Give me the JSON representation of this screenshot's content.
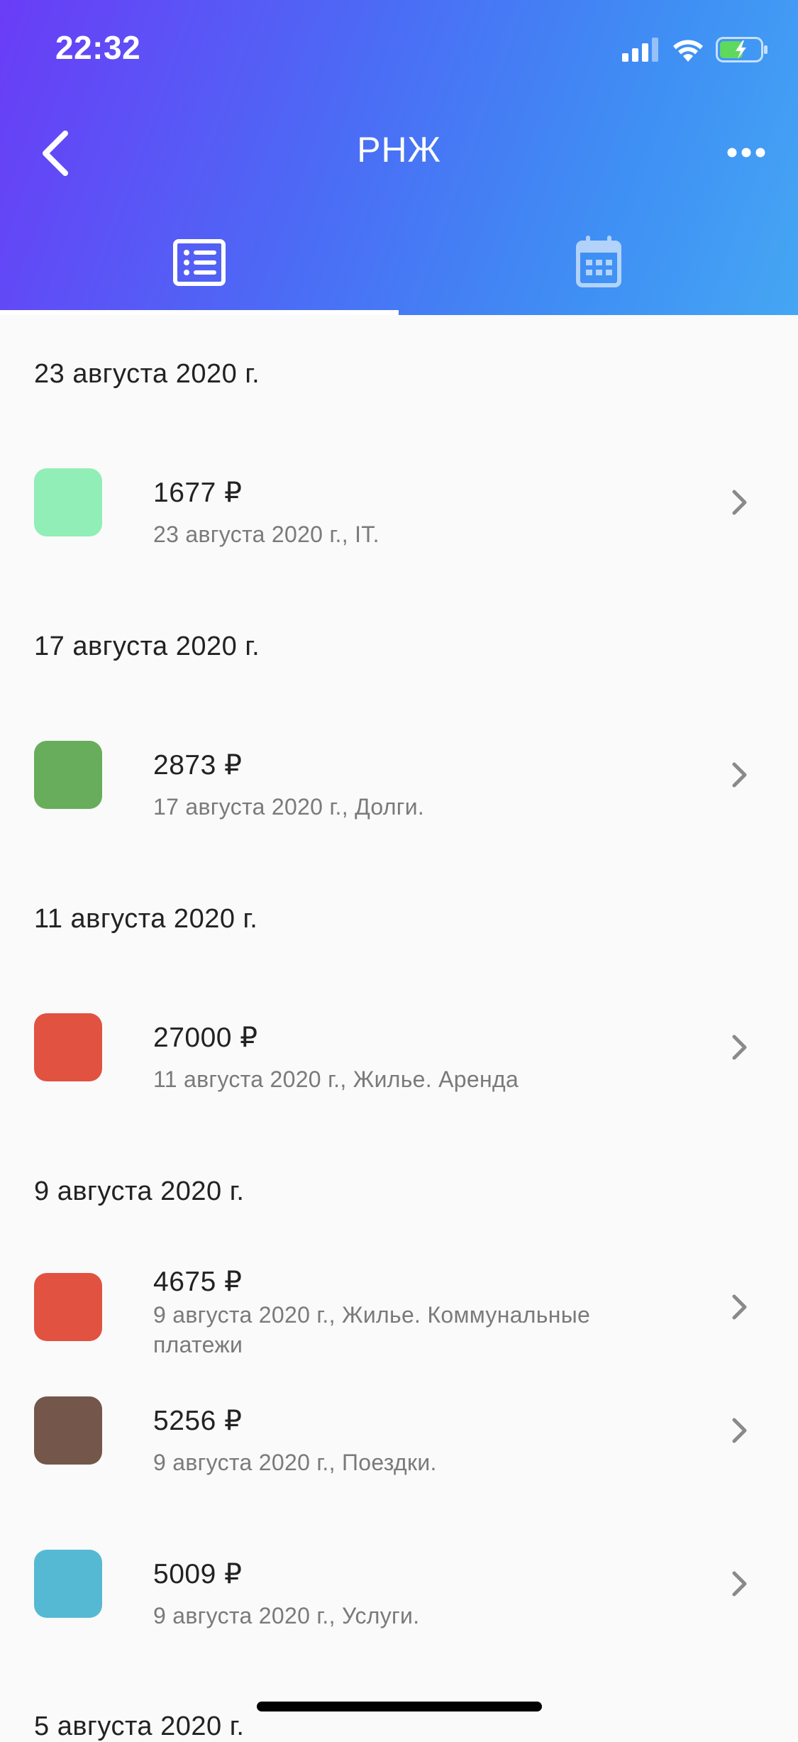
{
  "status_bar": {
    "time": "22:32"
  },
  "nav": {
    "title": "РНЖ"
  },
  "tabs": [
    {
      "name": "list-tab",
      "icon": "list-icon",
      "selected": true
    },
    {
      "name": "calendar-tab",
      "icon": "calendar-icon",
      "selected": false
    }
  ],
  "groups": [
    {
      "date": "23 августа 2020 г.",
      "items": [
        {
          "amount": "1677 ₽",
          "subtitle": "23 августа 2020 г., IT.",
          "color": "#90eeb6"
        }
      ]
    },
    {
      "date": "17 августа 2020 г.",
      "items": [
        {
          "amount": "2873 ₽",
          "subtitle": "17 августа 2020 г., Долги.",
          "color": "#67ad5b"
        }
      ]
    },
    {
      "date": "11 августа 2020 г.",
      "items": [
        {
          "amount": "27000 ₽",
          "subtitle": "11 августа 2020 г., Жилье. Аренда",
          "color": "#e15241"
        }
      ]
    },
    {
      "date": "9 августа 2020 г.",
      "items": [
        {
          "amount": "4675 ₽",
          "subtitle": "9 августа 2020 г., Жилье. Коммунальные платежи",
          "color": "#e15241"
        },
        {
          "amount": "5256 ₽",
          "subtitle": "9 августа 2020 г., Поездки.",
          "color": "#74574a"
        },
        {
          "amount": "5009 ₽",
          "subtitle": "9 августа 2020 г., Услуги.",
          "color": "#55b9d3"
        }
      ]
    },
    {
      "date": "5 августа 2020 г.",
      "items": []
    }
  ],
  "colors": {
    "header_gradient_start": "#6a3cf6",
    "header_gradient_end": "#45a6f3",
    "battery_fill": "#5ed95e"
  }
}
